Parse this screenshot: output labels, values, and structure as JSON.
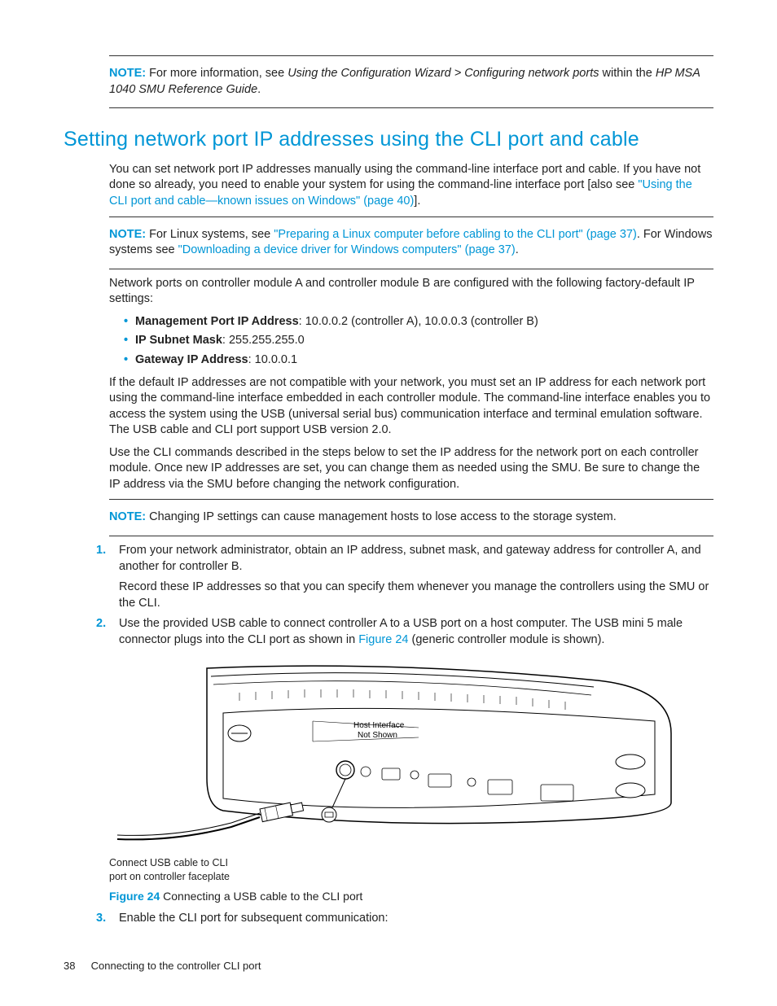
{
  "note1": {
    "label": "NOTE:",
    "text_a": "For more information, see ",
    "text_b": "Using the Configuration Wizard > Configuring network ports",
    "text_c": " within the ",
    "text_d": "HP MSA 1040 SMU Reference Guide",
    "text_e": "."
  },
  "heading": "Setting network port IP addresses using the CLI port and cable",
  "intro": {
    "p1a": "You can set network port IP addresses manually using the command-line interface port and cable. If you have not done so already, you need to enable your system for using the command-line interface port [also see ",
    "p1link": "\"Using the CLI port and cable—known issues on Windows\" (page 40)",
    "p1b": "]."
  },
  "note2": {
    "label": "NOTE:",
    "a": "For Linux systems, see ",
    "link1": "\"Preparing a Linux computer before cabling to the CLI port\" (page 37)",
    "b": ". For Windows systems see ",
    "link2": "\"Downloading a device driver for Windows computers\" (page 37)",
    "c": "."
  },
  "defaults_intro": "Network ports on controller module A and controller module B are configured with the following factory-default IP settings:",
  "bullets": {
    "b1_label": "Management Port IP Address",
    "b1_val": ": 10.0.0.2 (controller A), 10.0.0.3 (controller B)",
    "b2_label": "IP Subnet Mask",
    "b2_val": ": 255.255.255.0",
    "b3_label": "Gateway IP Address",
    "b3_val": ": 10.0.0.1"
  },
  "para2": "If the default IP addresses are not compatible with your network, you must set an IP address for each network port using the command-line interface embedded in each controller module. The command-line interface enables you to access the system using the USB (universal serial bus) communication interface and terminal emulation software. The USB cable and CLI port support USB version 2.0.",
  "para3": "Use the CLI commands described in the steps below to set the IP address for the network port on each controller module. Once new IP addresses are set, you can change them as needed using the SMU. Be sure to change the IP address via the SMU before changing the network configuration.",
  "note3": {
    "label": "NOTE:",
    "text": "Changing IP settings can cause management hosts to lose access to the storage system."
  },
  "steps": {
    "s1a": "From your network administrator, obtain an IP address, subnet mask, and gateway address for controller A, and another for controller B.",
    "s1b": "Record these IP addresses so that you can specify them whenever you manage the controllers using the SMU or the CLI.",
    "s2a": "Use the provided USB cable to connect controller A to a USB port on a host computer. The USB mini 5 male connector plugs into the CLI port as shown in ",
    "s2link": "Figure 24",
    "s2b": " (generic controller module is shown).",
    "s3": "Enable the CLI port for subsequent communication:"
  },
  "diagram": {
    "label1": "Host Interface",
    "label2": "Not Shown",
    "caption1": "Connect USB cable to CLI",
    "caption2": "port on controller faceplate"
  },
  "figure": {
    "label": "Figure 24",
    "text": " Connecting a USB cable to the CLI port"
  },
  "footer": {
    "page": "38",
    "title": "Connecting to the controller CLI port"
  }
}
